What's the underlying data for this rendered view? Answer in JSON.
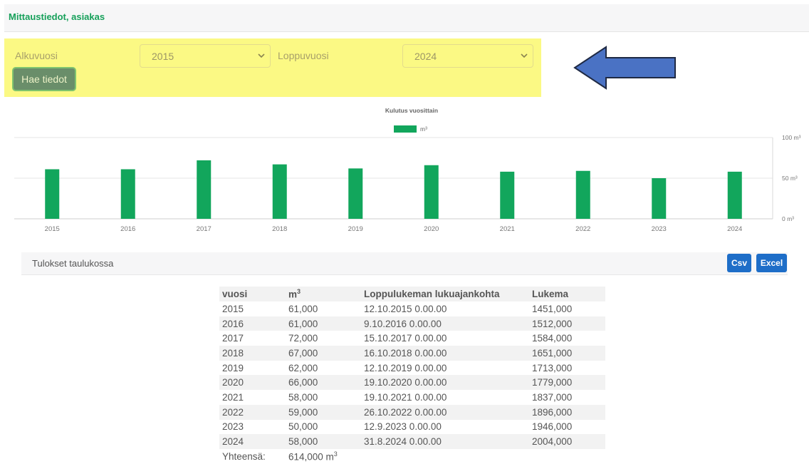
{
  "header": {
    "title": "Mittaustiedot, asiakas"
  },
  "filters": {
    "start_label": "Alkuvuosi",
    "start_value": "2015",
    "end_label": "Loppuvuosi",
    "end_value": "2024",
    "submit_label": "Hae tiedot"
  },
  "annotation": {
    "arrow_color": "#4a72c4"
  },
  "chart_data": {
    "type": "bar",
    "title": "Kulutus vuosittain",
    "categories": [
      "2015",
      "2016",
      "2017",
      "2018",
      "2019",
      "2020",
      "2021",
      "2022",
      "2023",
      "2024"
    ],
    "series": [
      {
        "name": "m³",
        "values": [
          61,
          61,
          72,
          67,
          62,
          66,
          58,
          59,
          50,
          58
        ],
        "color": "#12a65c"
      }
    ],
    "ylim": [
      0,
      100
    ],
    "yticks": [
      "0 m³",
      "50 m³",
      "100 m³"
    ],
    "y_axis_position": "right",
    "legend": "top",
    "grid": true
  },
  "results": {
    "title": "Tulokset taulukossa",
    "csv_label": "Csv",
    "excel_label": "Excel"
  },
  "table": {
    "headers": {
      "year": "vuosi",
      "m3_unit": "m",
      "m3_exp": "3",
      "reading_time": "Loppulukeman lukuajankohta",
      "reading": "Lukema"
    },
    "rows": [
      [
        "2015",
        "61,000",
        "12.10.2015 0.00.00",
        "1451,000"
      ],
      [
        "2016",
        "61,000",
        "9.10.2016 0.00.00",
        "1512,000"
      ],
      [
        "2017",
        "72,000",
        "15.10.2017 0.00.00",
        "1584,000"
      ],
      [
        "2018",
        "67,000",
        "16.10.2018 0.00.00",
        "1651,000"
      ],
      [
        "2019",
        "62,000",
        "12.10.2019 0.00.00",
        "1713,000"
      ],
      [
        "2020",
        "66,000",
        "19.10.2020 0.00.00",
        "1779,000"
      ],
      [
        "2021",
        "58,000",
        "19.10.2021 0.00.00",
        "1837,000"
      ],
      [
        "2022",
        "59,000",
        "26.10.2022 0.00.00",
        "1896,000"
      ],
      [
        "2023",
        "50,000",
        "12.9.2023 0.00.00",
        "1946,000"
      ],
      [
        "2024",
        "58,000",
        "31.8.2024 0.00.00",
        "2004,000"
      ]
    ],
    "total_label": "Yhteensä:",
    "total_value": "614,000 m",
    "total_exp": "3"
  }
}
